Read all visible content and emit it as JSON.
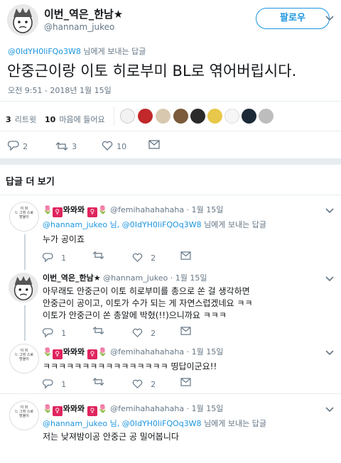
{
  "main_tweet": {
    "display_name": "이번_역은_한남★",
    "handle": "@hannam_jukeo",
    "follow_label": "팔로우",
    "reply_to_handle": "@0IdYH0liFQo3W8",
    "reply_to_suffix": "님에게 보내는 답글",
    "text": "안중근이랑 이토 히로부미 BL로 엮어버립시다.",
    "timestamp": "오전 9:51 - 2018년 1월 15일",
    "retweets_count": "3",
    "retweets_label": "리트윗",
    "likes_count": "10",
    "likes_label": "마음에 들어요",
    "action_reply_count": "2",
    "action_retweet_count": "3",
    "action_like_count": "10"
  },
  "more_replies_label": "답글 더 보기",
  "replies": [
    {
      "display_name": "🌷🚺뫄뫄뫄🚺🌷",
      "name_text": "뫄뫄뫄",
      "handle": "@femihahahahaha",
      "date": "· 1월 15일",
      "reply_to_handles": "@hannam_jukeo 님, @0IdYH0liFQOq3W8",
      "reply_to_suffix": "님에게 보내는 답글",
      "text": "누가 공이죠",
      "reply_count": "1",
      "like_count": "2"
    },
    {
      "display_name": "이번_역은_한남★",
      "handle": "@hannam_jukeo",
      "date": "· 1월 15일",
      "text_lines": [
        "아무래도 안중근이 이토 히로부미를 총으로 쏜 걸 생각하면",
        "안중근이 공이고, 이토가 수가 되는 게 자연스럽겠네요 ㅋㅋ",
        "이토가 안중근이 쏜 총알에 박혔(!!)으니까요 ㅋㅋㅋ"
      ],
      "reply_count": "1",
      "like_count": "2"
    },
    {
      "display_name": "🌷🚺뫄뫄뫄🚺🌷",
      "name_text": "뫄뫄뫄",
      "handle": "@femihahahahaha",
      "date": "· 1월 15일",
      "text": "ㅋㅋㅋㅋㅋㅋㅋㅋㅋㅋㅋㅋㅋㅋㅋㅋ 띵답이군요!!",
      "reply_count": "1",
      "like_count": "2"
    },
    {
      "display_name": "🌷🚺뫄뫄뫄🚺🌷",
      "name_text": "뫄뫄뫄",
      "handle": "@femihahahahaha",
      "date": "· 1월 15일",
      "reply_to_handles": "@hannam_jukeo 님, @0IdYH0liFQOq3W8",
      "reply_to_suffix": "님에게 보내는 답글",
      "text": "저는 낮져밤이공 안중근 공 밀어봅니다"
    }
  ],
  "femi_avatar_lines": [
    "이 뒤",
    "느 그뮈 스로",
    "방울이"
  ],
  "colors": {
    "accent": "#1b95e0",
    "muted": "#657786",
    "border": "#e6ecf0",
    "flag": "#e0245e"
  }
}
